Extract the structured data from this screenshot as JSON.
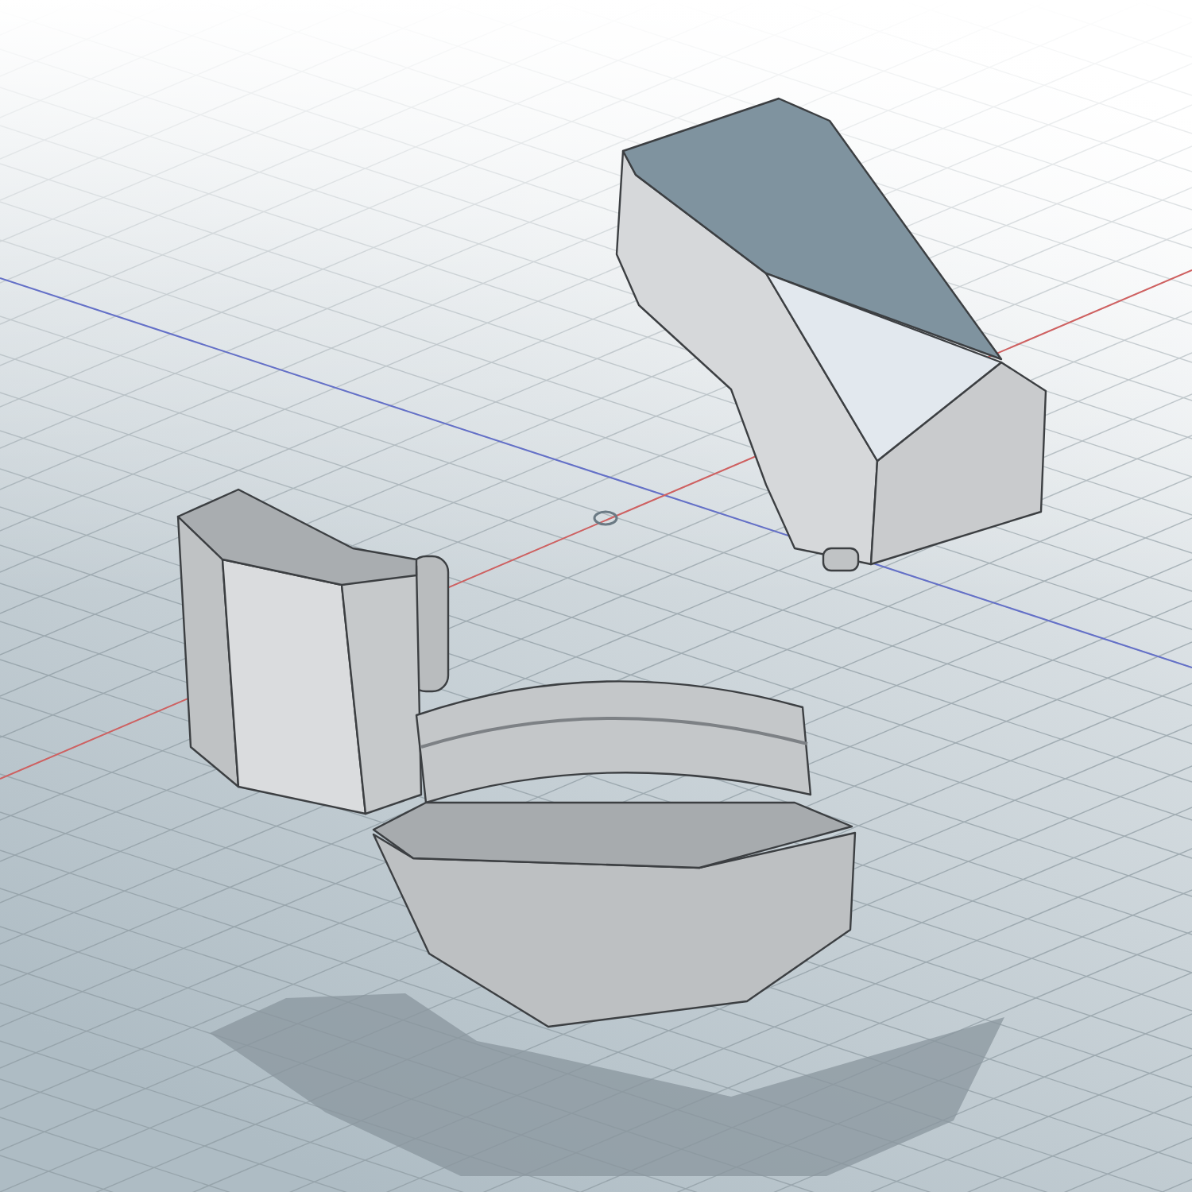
{
  "viewport": {
    "shadow": true,
    "parts": [
      {
        "kind": "upper"
      },
      {
        "kind": "left"
      },
      {
        "kind": "lower"
      }
    ]
  }
}
